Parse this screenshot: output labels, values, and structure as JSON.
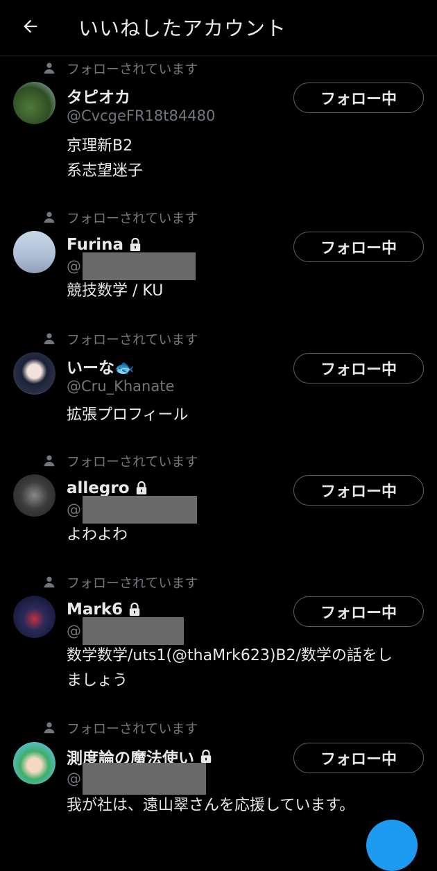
{
  "header": {
    "title": "いいねしたアカウント",
    "back_icon": "arrow-left-icon"
  },
  "followed_label": "フォローされています",
  "follow_button_label": "フォロー中",
  "colors": {
    "background": "#000000",
    "text": "#e7e9ea",
    "muted": "#71767b",
    "border": "#536471",
    "accent": "#1d9bf0"
  },
  "users": [
    {
      "name": "タピオカ",
      "handle": "@CvcgeFR18t84480",
      "locked": false,
      "bio": [
        "京理新B2",
        "系志望迷子"
      ]
    },
    {
      "name": "Furina",
      "handle": "@",
      "locked": true,
      "redacted": true,
      "bio": [
        "競技数学 / KU"
      ]
    },
    {
      "name": "いーな🐟",
      "handle": "@Cru_Khanate",
      "locked": false,
      "bio": [
        "拡張プロフィール"
      ]
    },
    {
      "name": "allegro",
      "handle": "@",
      "locked": true,
      "redacted": true,
      "bio": [
        "よわよわ"
      ]
    },
    {
      "name": "Mark6",
      "handle": "@",
      "locked": true,
      "redacted": true,
      "bio": [
        "数学数学/uts1(@thaMrk623)B2/数学の話をし",
        "ましょう"
      ]
    },
    {
      "name": "測度論の魔法使い",
      "handle": "@",
      "locked": true,
      "redacted": true,
      "bio": [
        "我が社は、遠山翠さんを応援しています。"
      ]
    }
  ]
}
